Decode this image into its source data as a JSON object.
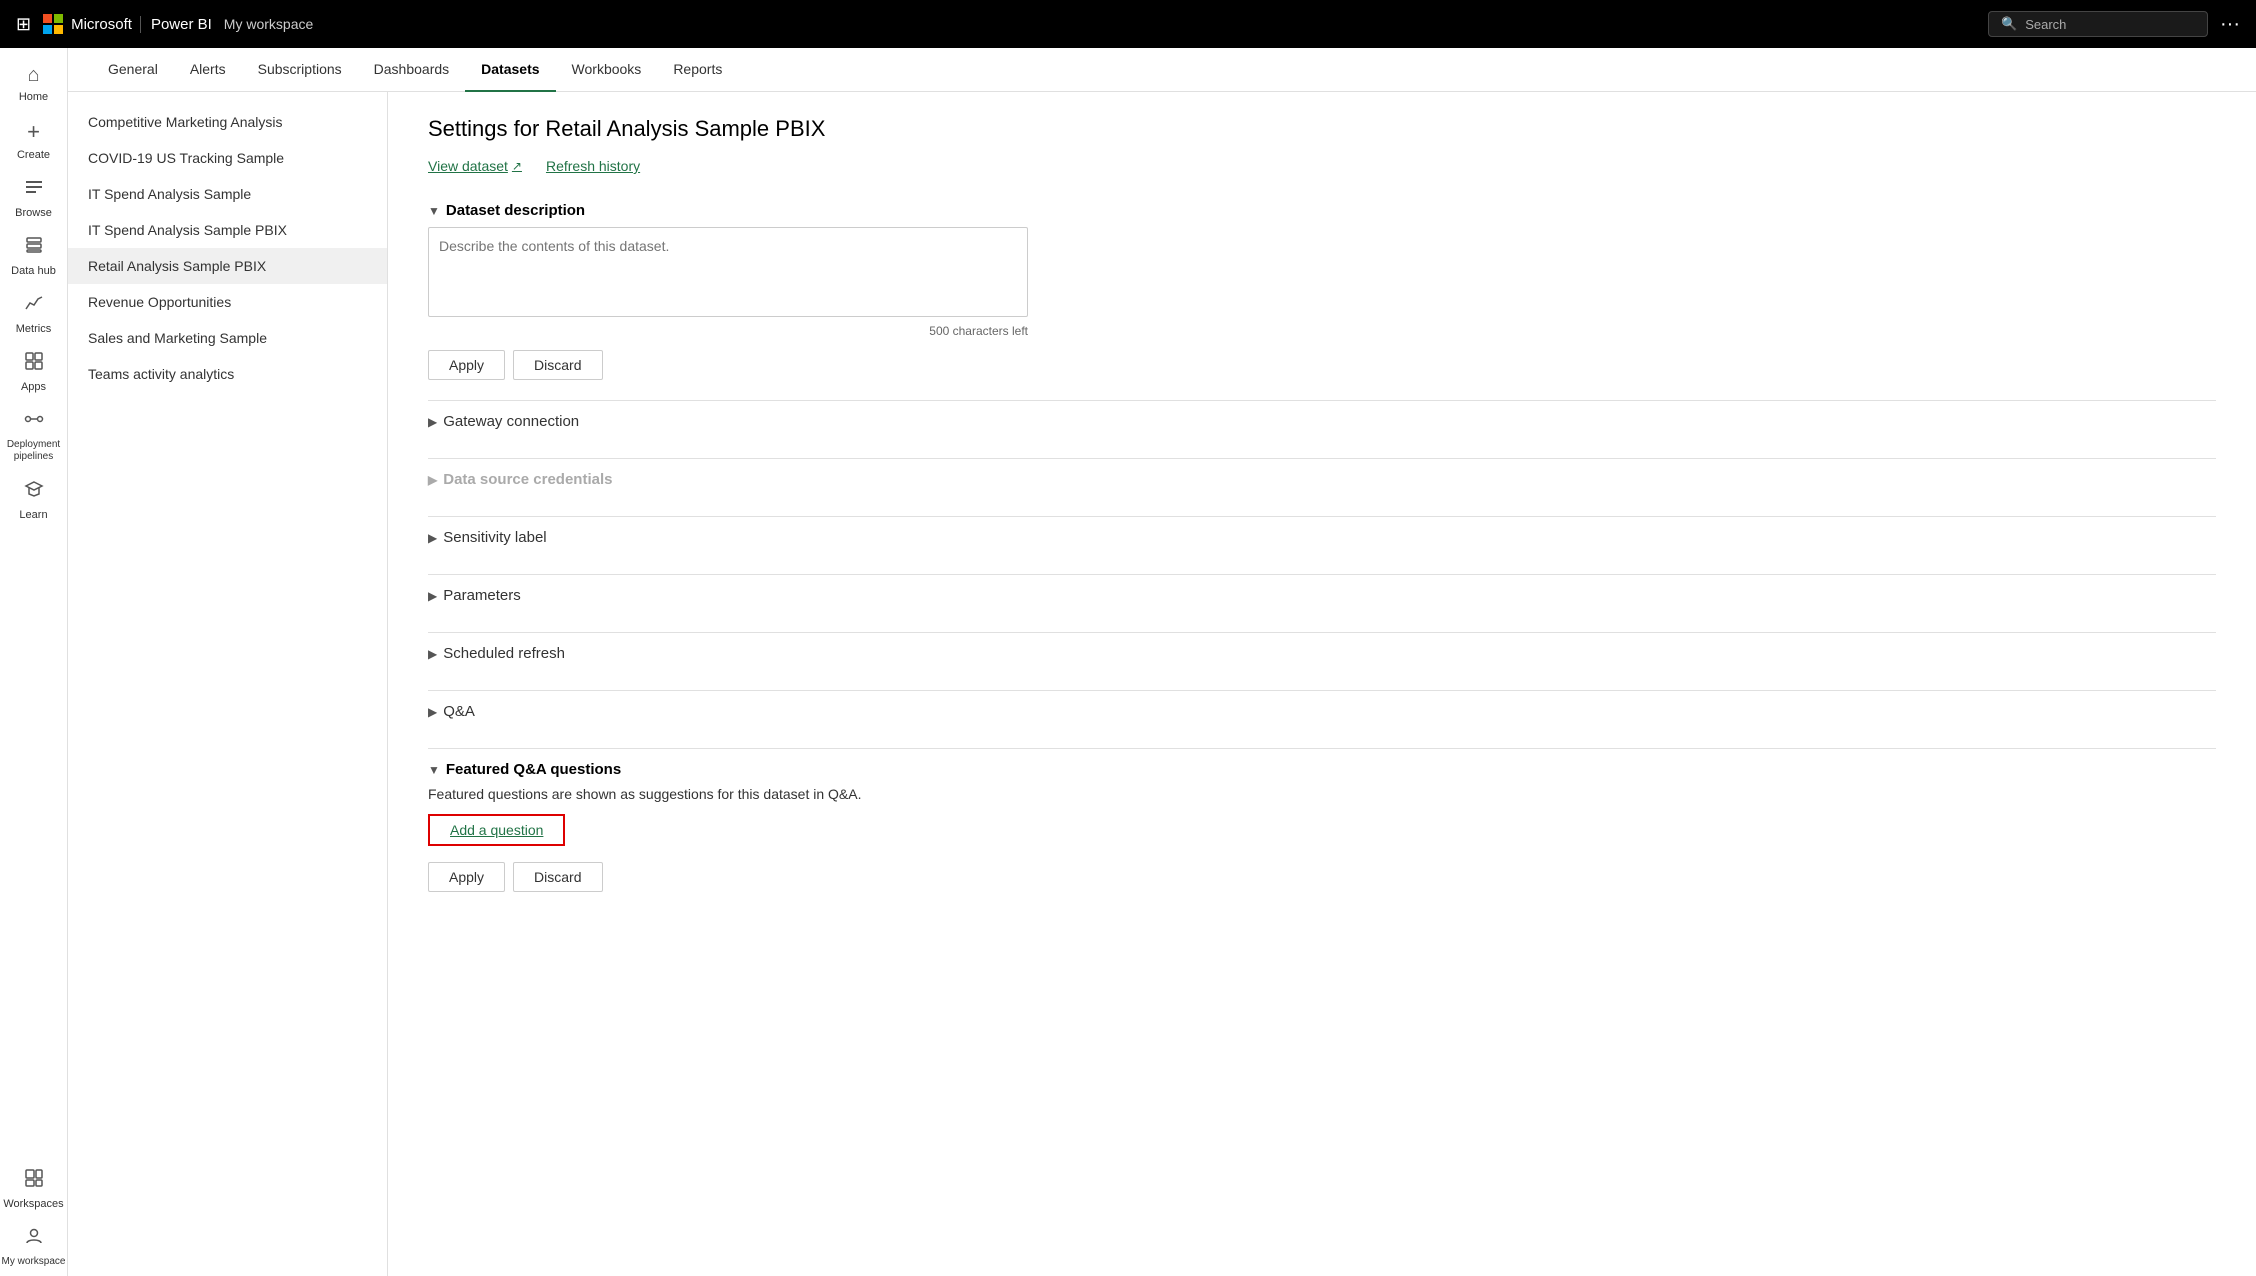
{
  "topbar": {
    "grid_icon": "⊞",
    "brand": "Microsoft",
    "product": "Power BI",
    "workspace": "My workspace",
    "search_placeholder": "Search",
    "more_icon": "···"
  },
  "sidebar": {
    "items": [
      {
        "id": "home",
        "label": "Home",
        "icon": "⌂"
      },
      {
        "id": "create",
        "label": "Create",
        "icon": "+"
      },
      {
        "id": "browse",
        "label": "Browse",
        "icon": "☰"
      },
      {
        "id": "datahub",
        "label": "Data hub",
        "icon": "🗄"
      },
      {
        "id": "metrics",
        "label": "Metrics",
        "icon": "📊"
      },
      {
        "id": "apps",
        "label": "Apps",
        "icon": "⊞"
      },
      {
        "id": "deployment",
        "label": "Deployment pipelines",
        "icon": "↔"
      },
      {
        "id": "learn",
        "label": "Learn",
        "icon": "🎓"
      },
      {
        "id": "workspaces",
        "label": "Workspaces",
        "icon": "🗂"
      },
      {
        "id": "myworkspace",
        "label": "My workspace",
        "icon": "👤"
      }
    ]
  },
  "tabs": [
    {
      "id": "general",
      "label": "General",
      "active": false
    },
    {
      "id": "alerts",
      "label": "Alerts",
      "active": false
    },
    {
      "id": "subscriptions",
      "label": "Subscriptions",
      "active": false
    },
    {
      "id": "dashboards",
      "label": "Dashboards",
      "active": false
    },
    {
      "id": "datasets",
      "label": "Datasets",
      "active": true
    },
    {
      "id": "workbooks",
      "label": "Workbooks",
      "active": false
    },
    {
      "id": "reports",
      "label": "Reports",
      "active": false
    }
  ],
  "dataset_list": [
    {
      "id": "competitive",
      "label": "Competitive Marketing Analysis",
      "active": false
    },
    {
      "id": "covid",
      "label": "COVID-19 US Tracking Sample",
      "active": false
    },
    {
      "id": "itspend",
      "label": "IT Spend Analysis Sample",
      "active": false
    },
    {
      "id": "itspendpbix",
      "label": "IT Spend Analysis Sample PBIX",
      "active": false
    },
    {
      "id": "retail",
      "label": "Retail Analysis Sample PBIX",
      "active": true
    },
    {
      "id": "revenue",
      "label": "Revenue Opportunities",
      "active": false
    },
    {
      "id": "sales",
      "label": "Sales and Marketing Sample",
      "active": false
    },
    {
      "id": "teams",
      "label": "Teams activity analytics",
      "active": false
    }
  ],
  "main": {
    "page_title": "Settings for Retail Analysis Sample PBIX",
    "view_dataset_label": "View dataset",
    "refresh_history_label": "Refresh history",
    "sections": {
      "dataset_description": {
        "label": "Dataset description",
        "expanded": true,
        "textarea_placeholder": "Describe the contents of this dataset.",
        "char_count": "500 characters left",
        "apply_label": "Apply",
        "discard_label": "Discard"
      },
      "gateway_connection": {
        "label": "Gateway connection",
        "expanded": false
      },
      "data_source_credentials": {
        "label": "Data source credentials",
        "expanded": false,
        "disabled": true
      },
      "sensitivity_label": {
        "label": "Sensitivity label",
        "expanded": false
      },
      "parameters": {
        "label": "Parameters",
        "expanded": false
      },
      "scheduled_refresh": {
        "label": "Scheduled refresh",
        "expanded": false
      },
      "qa": {
        "label": "Q&A",
        "expanded": false
      },
      "featured_qa": {
        "label": "Featured Q&A questions",
        "expanded": true,
        "description": "Featured questions are shown as suggestions for this dataset in Q&A.",
        "add_question_label": "Add a question",
        "apply_label": "Apply",
        "discard_label": "Discard"
      }
    }
  }
}
